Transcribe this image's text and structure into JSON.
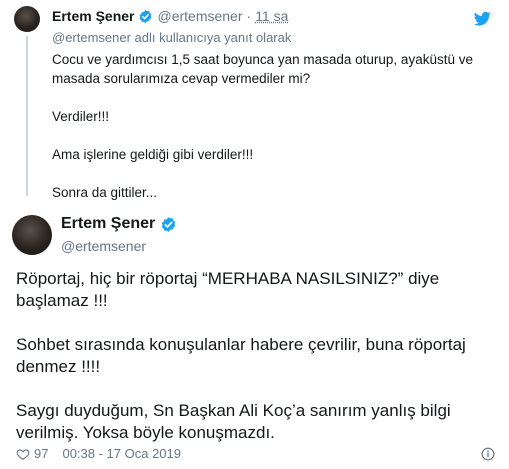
{
  "quoted_tweet": {
    "name": "Ertem Şener",
    "handle": "@ertemsener",
    "separator": "·",
    "time": "11 sa",
    "reply_to": "@ertemsener adlı kullanıcıya yanıt olarak",
    "paragraphs": [
      "Cocu ve yardımcısı 1,5 saat boyunca yan masada oturup, ayaküstü ve masada sorularımıza cevap vermediler mi?",
      "Verdiler!!!",
      "Ama işlerine geldiği gibi verdiler!!!",
      "Sonra da gittiler..."
    ]
  },
  "main_tweet": {
    "name": "Ertem Şener",
    "handle": "@ertemsener",
    "paragraphs": [
      "Röportaj, hiç bir röportaj “MERHABA NASILSINIZ?” diye başlamaz !!!",
      "Sohbet sırasında konuşulanlar habere çevrilir, buna röportaj denmez !!!!",
      "Saygı duyduğum, Sn Başkan Ali Koç’a sanırım yanlış bilgi verilmiş. Yoksa böyle konuşmazdı."
    ]
  },
  "footer": {
    "likes": "97",
    "timestamp": "00:38 - 17 Oca 2019"
  },
  "colors": {
    "verified": "#1da1f2",
    "twitter_blue": "#1da1f2",
    "secondary_text": "#657786",
    "primary_text": "#14171a"
  },
  "icons": [
    "verified-badge-icon",
    "twitter-bird-icon",
    "heart-icon",
    "info-icon"
  ]
}
